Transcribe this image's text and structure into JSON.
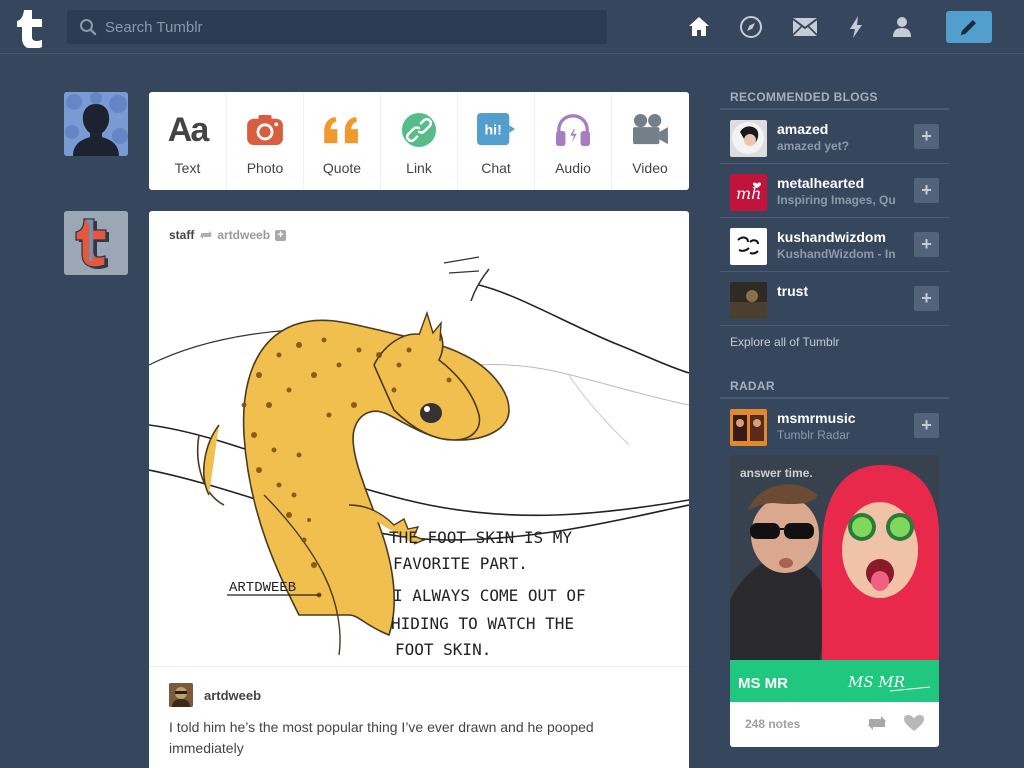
{
  "header": {
    "search_placeholder": "Search Tumblr",
    "nav": [
      "home-icon",
      "explore-icon",
      "inbox-icon",
      "activity-icon",
      "account-icon"
    ],
    "compose_icon": "pencil-icon"
  },
  "post_types": [
    {
      "label": "Text",
      "icon": "text-icon",
      "color": "#444444"
    },
    {
      "label": "Photo",
      "icon": "camera-icon",
      "color": "#d95e40"
    },
    {
      "label": "Quote",
      "icon": "quote-icon",
      "color": "#f2992e"
    },
    {
      "label": "Link",
      "icon": "link-icon",
      "color": "#56bc8a"
    },
    {
      "label": "Chat",
      "icon": "chat-icon",
      "color": "#529ecc"
    },
    {
      "label": "Audio",
      "icon": "headphones-icon",
      "color": "#a77dc2"
    },
    {
      "label": "Video",
      "icon": "video-camera-icon",
      "color": "#748089"
    }
  ],
  "post": {
    "author": "staff",
    "source": "artdweeb",
    "image_text": [
      "THE FOOT SKIN IS MY",
      "FAVORITE PART.",
      "I ALWAYS COME OUT OF",
      "HIDING TO WATCH THE",
      "FOOT SKIN."
    ],
    "signature": "ARTDWEEB",
    "reblogger": "artdweeb",
    "reblog_text": "I told him he’s the most popular thing I’ve ever drawn and he pooped immediately"
  },
  "sidebar": {
    "recommended_title": "RECOMMENDED BLOGS",
    "blogs": [
      {
        "name": "amazed",
        "subtitle": "amazed yet?"
      },
      {
        "name": "metalhearted",
        "subtitle": "Inspiring Images, Qu"
      },
      {
        "name": "kushandwizdom",
        "subtitle": "KushandWizdom - In"
      },
      {
        "name": "trust",
        "subtitle": ""
      }
    ],
    "add_label": "+",
    "explore_label": "Explore all of Tumblr",
    "radar_title": "RADAR",
    "radar": {
      "name": "msmrmusic",
      "subtitle": "Tumblr Radar",
      "image_caption": "answer time.",
      "banner": "MS MR",
      "banner_script": "MS MR",
      "notes": "248 notes"
    }
  },
  "colors": {
    "background": "#36465d",
    "compose": "#529ecc",
    "radar_banner": "#1fc87e"
  }
}
